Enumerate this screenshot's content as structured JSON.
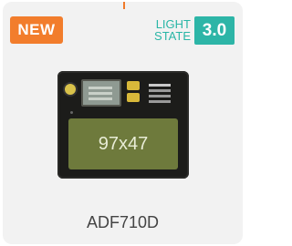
{
  "product_card": {
    "badge_new": "NEW",
    "light_state": {
      "line1": "LIGHT",
      "line2": "STATE",
      "version": "3.0"
    },
    "lens_size": "97x47",
    "model_name": "ADF710D",
    "colors": {
      "badge_new_bg": "#f27d2c",
      "light_state_accent": "#2db5a7",
      "card_bg": "#f2f2f2",
      "lcd_green": "#6e7a3c"
    }
  }
}
